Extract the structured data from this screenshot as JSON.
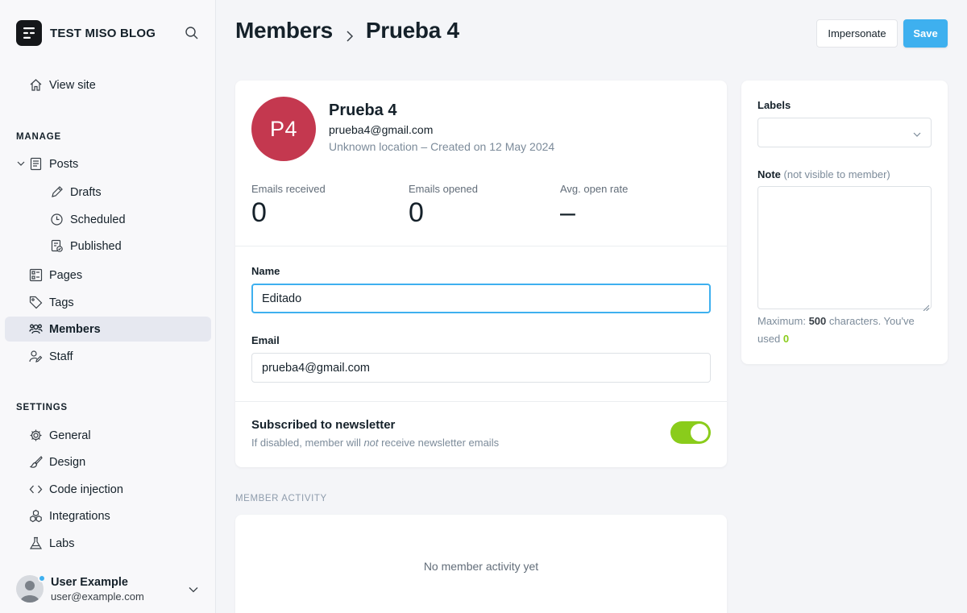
{
  "sidebar": {
    "site_title": "TEST MISO BLOG",
    "view_site": "View site",
    "manage_heading": "MANAGE",
    "posts": "Posts",
    "drafts": "Drafts",
    "scheduled": "Scheduled",
    "published": "Published",
    "pages": "Pages",
    "tags": "Tags",
    "members": "Members",
    "staff": "Staff",
    "settings_heading": "SETTINGS",
    "general": "General",
    "design": "Design",
    "code_injection": "Code injection",
    "integrations": "Integrations",
    "labs": "Labs",
    "user_name": "User Example",
    "user_email": "user@example.com"
  },
  "header": {
    "breadcrumb_parent": "Members",
    "breadcrumb_current": "Prueba 4",
    "impersonate_label": "Impersonate",
    "save_label": "Save"
  },
  "member": {
    "initials": "P4",
    "name": "Prueba 4",
    "email": "prueba4@gmail.com",
    "meta": "Unknown location – Created on 12 May 2024",
    "stats": {
      "emails_received_label": "Emails received",
      "emails_received": "0",
      "emails_opened_label": "Emails opened",
      "emails_opened": "0",
      "open_rate_label": "Avg. open rate",
      "open_rate": "–"
    },
    "form": {
      "name_label": "Name",
      "name_value": "Editado",
      "email_label": "Email",
      "email_value": "prueba4@gmail.com"
    },
    "newsletter": {
      "title": "Subscribed to newsletter",
      "desc_before": "If disabled, member will ",
      "desc_em": "not",
      "desc_after": " receive newsletter emails",
      "subscribed": true
    }
  },
  "activity": {
    "heading": "MEMBER ACTIVITY",
    "empty": "No member activity yet"
  },
  "side": {
    "labels_label": "Labels",
    "note_label": "Note",
    "note_hint": "(not visible to member)",
    "note_help_a": "Maximum: ",
    "note_help_max": "500",
    "note_help_b": " characters. You've used ",
    "note_help_used": "0"
  },
  "colors": {
    "accent": "#3eb0ef",
    "toggle_on": "#8acc1b",
    "avatar": "#c4384f"
  }
}
